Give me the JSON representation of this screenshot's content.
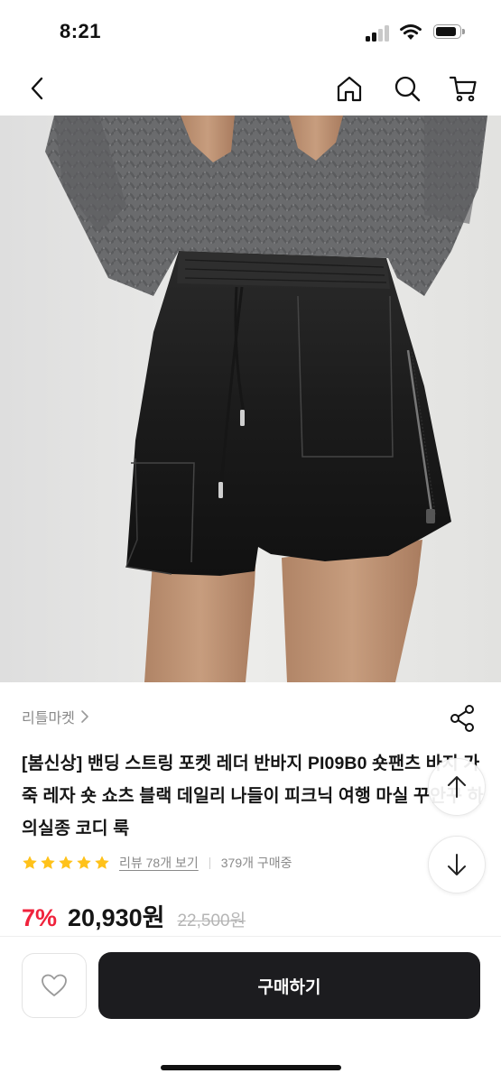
{
  "status_bar": {
    "time": "8:21"
  },
  "nav": {
    "back_icon": "chevron-left-icon",
    "home_icon": "home-icon",
    "search_icon": "search-icon",
    "cart_icon": "cart-icon"
  },
  "product": {
    "image_icon": "product-photo-leather-shorts",
    "store_name": "리틀마켓",
    "title": "[봄신상] 밴딩 스트링 포켓 레더 반바지 PI09B0 숏팬츠 바지 가죽 레자 숏 쇼츠 블랙 데일리 나들이 피크닉 여행 마실 꾸안꾸 하의실종 코디 룩",
    "rating_stars": 5,
    "review_link": "리뷰 78개 보기",
    "purchase_count": "379개 구매중",
    "discount": "7%",
    "price": "20,930원",
    "original_price": "22,500원"
  },
  "actions": {
    "buy_label": "구매하기",
    "wish_icon": "heart-icon",
    "share_icon": "share-icon",
    "scroll_up_icon": "arrow-up-icon",
    "scroll_down_icon": "arrow-down-icon"
  },
  "colors": {
    "accent_discount": "#f0233c",
    "star": "#ffc21a",
    "buy_button": "#1c1c1f"
  }
}
